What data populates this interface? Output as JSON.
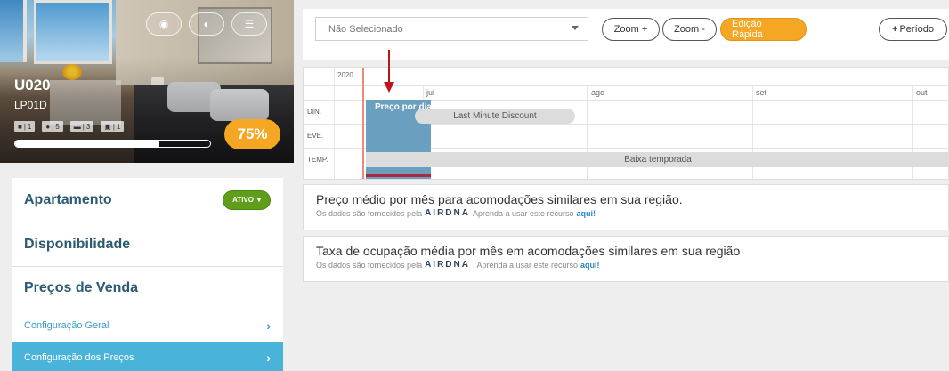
{
  "unit": {
    "code": "U020",
    "sub": "LP01D",
    "occupancy": "75%",
    "progress_fraction": 0.74,
    "specs": [
      {
        "icon": "door-icon",
        "value": "1"
      },
      {
        "icon": "person-icon",
        "value": "5"
      },
      {
        "icon": "bed-icon",
        "value": "3"
      },
      {
        "icon": "bath-icon",
        "value": "1"
      }
    ]
  },
  "menu": {
    "apartamento": "Apartamento",
    "status": "ATIVO",
    "disponibilidade": "Disponibilidade",
    "precos": "Preços de Venda",
    "config_geral": "Configuração Geral",
    "config_precos": "Configuração dos Preços"
  },
  "toolbar": {
    "select_value": "Não Selecionado",
    "zoom_in": "Zoom +",
    "zoom_out": "Zoom -",
    "quick_edit": "Edição Rápida",
    "period": "Período"
  },
  "timeline": {
    "year": "2020",
    "months": [
      "jul",
      "ago",
      "set",
      "out"
    ],
    "rows": [
      "DIN.",
      "EVE.",
      "TEMP."
    ],
    "price_label": "Preço por dia",
    "discount": "Last Minute Discount",
    "season": "Baixa temporada"
  },
  "cards": [
    {
      "title": "Preço médio por mês para acomodações similares em sua região.",
      "note_prefix": "Os dados são fornecidos pela",
      "brand": "AIRDNA",
      "note_mid": "Aprenda a usar este recurso",
      "link": "aqui!"
    },
    {
      "title": "Taxa de ocupação média por mês em acomodações similares em sua região",
      "note_prefix": "Os dados são fornecidos pela",
      "brand": "AIRDNA",
      "note_mid": ". Aprenda a usar este recurso",
      "link": "aqui!"
    }
  ],
  "colors": {
    "accent": "#f5a623",
    "active": "#4ab3d9",
    "status": "#5f9e1a",
    "arrow": "#c0141b"
  }
}
